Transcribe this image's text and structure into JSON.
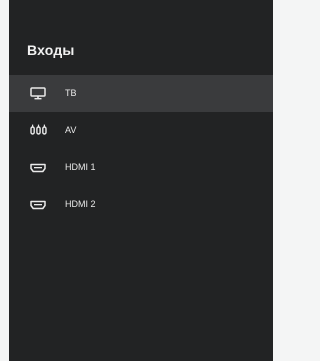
{
  "screen": {
    "title": "Входы",
    "inputs": [
      {
        "label": "ТВ",
        "icon": "tv-icon",
        "selected": true
      },
      {
        "label": "AV",
        "icon": "av-connector-icon",
        "selected": false
      },
      {
        "label": "HDMI 1",
        "icon": "hdmi-icon",
        "selected": false
      },
      {
        "label": "HDMI 2",
        "icon": "hdmi-icon",
        "selected": false
      }
    ]
  },
  "colors": {
    "panel_bg": "#222324",
    "selected_bg": "#3a3b3d",
    "text": "#eaeaea"
  }
}
